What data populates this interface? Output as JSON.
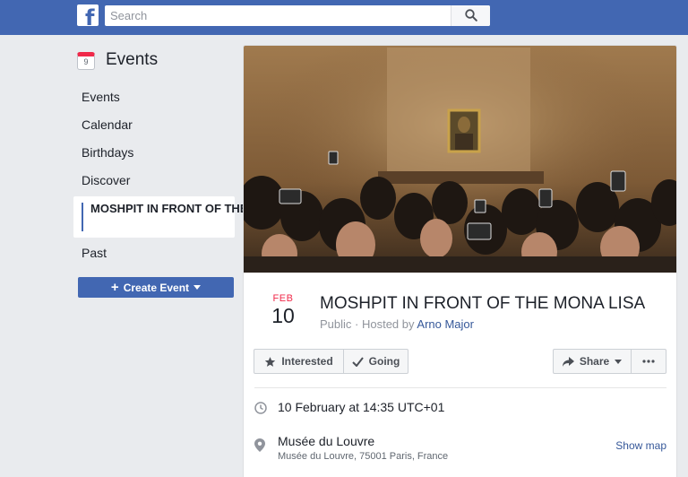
{
  "topbar": {
    "logo_letter": "f",
    "search_placeholder": "Search"
  },
  "sidebar": {
    "title": "Events",
    "calendar_day": "9",
    "items": [
      {
        "label": "Events"
      },
      {
        "label": "Calendar"
      },
      {
        "label": "Birthdays"
      },
      {
        "label": "Discover"
      },
      {
        "label": "MOSHPIT IN FRONT OF THE MONA LISA"
      },
      {
        "label": "Past"
      }
    ],
    "create_label": "Create Event"
  },
  "event": {
    "month": "FEB",
    "day": "10",
    "title": "MOSHPIT IN FRONT OF THE MONA LISA",
    "privacy": "Public · Hosted by",
    "host": "Arno Major",
    "interested_label": "Interested",
    "going_label": "Going",
    "share_label": "Share",
    "datetime": "10 February at 14:35 UTC+01",
    "venue": "Musée du Louvre",
    "address": "Musée du Louvre, 75001 Paris, France",
    "show_map_label": "Show map"
  },
  "colors": {
    "brand": "#4267b2",
    "background": "#e9ebee",
    "month_red": "#f02849",
    "link": "#365899"
  }
}
